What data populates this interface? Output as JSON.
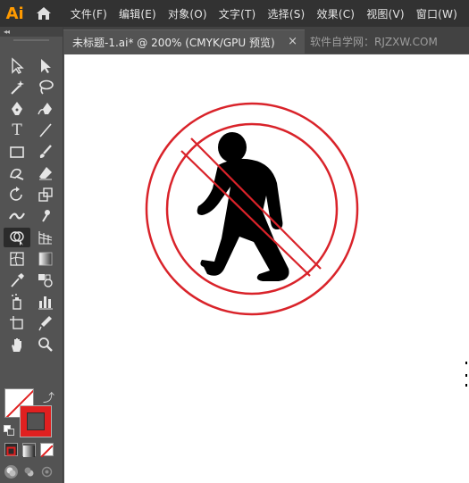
{
  "app": {
    "logo_text": "Ai",
    "logo_color": "#ff9a00",
    "home_icon": "home-icon"
  },
  "menu": {
    "items": [
      "文件(F)",
      "编辑(E)",
      "对象(O)",
      "文字(T)",
      "选择(S)",
      "效果(C)",
      "视图(V)",
      "窗口(W)"
    ]
  },
  "panel": {
    "collapse_glyph": "◂◂"
  },
  "document": {
    "active_tab": "未标题-1.ai* @ 200% (CMYK/GPU 预览)",
    "close_glyph": "×",
    "inactive_tab": "软件自学网：RJZXW.COM"
  },
  "tools": [
    {
      "name": "selection-tool",
      "active": false
    },
    {
      "name": "direct-selection-tool",
      "active": false
    },
    {
      "name": "magic-wand-tool",
      "active": false
    },
    {
      "name": "lasso-tool",
      "active": false
    },
    {
      "name": "pen-tool",
      "active": false
    },
    {
      "name": "curvature-tool",
      "active": false
    },
    {
      "name": "type-tool",
      "glyph": "T",
      "active": false
    },
    {
      "name": "line-segment-tool",
      "active": false
    },
    {
      "name": "rectangle-tool",
      "active": false
    },
    {
      "name": "paintbrush-tool",
      "active": false
    },
    {
      "name": "shaper-tool",
      "active": false
    },
    {
      "name": "eraser-tool",
      "active": false
    },
    {
      "name": "rotate-tool",
      "active": false
    },
    {
      "name": "scale-tool",
      "active": false
    },
    {
      "name": "width-tool",
      "active": false
    },
    {
      "name": "puppet-warp-tool",
      "active": false
    },
    {
      "name": "shape-builder-tool",
      "active": true
    },
    {
      "name": "perspective-grid-tool",
      "active": false
    },
    {
      "name": "mesh-tool",
      "active": false
    },
    {
      "name": "gradient-tool",
      "active": false
    },
    {
      "name": "eyedropper-tool",
      "active": false
    },
    {
      "name": "blend-tool",
      "active": false
    },
    {
      "name": "symbol-sprayer-tool",
      "active": false
    },
    {
      "name": "column-graph-tool",
      "active": false
    },
    {
      "name": "artboard-tool",
      "active": false
    },
    {
      "name": "slice-tool",
      "active": false
    },
    {
      "name": "hand-tool",
      "active": false
    },
    {
      "name": "zoom-tool",
      "active": false
    }
  ],
  "colors": {
    "fill": "none",
    "stroke": "#e02020",
    "swap_glyph": "⤴",
    "stroke_accent": "#d9232a",
    "figure": "#000000"
  }
}
